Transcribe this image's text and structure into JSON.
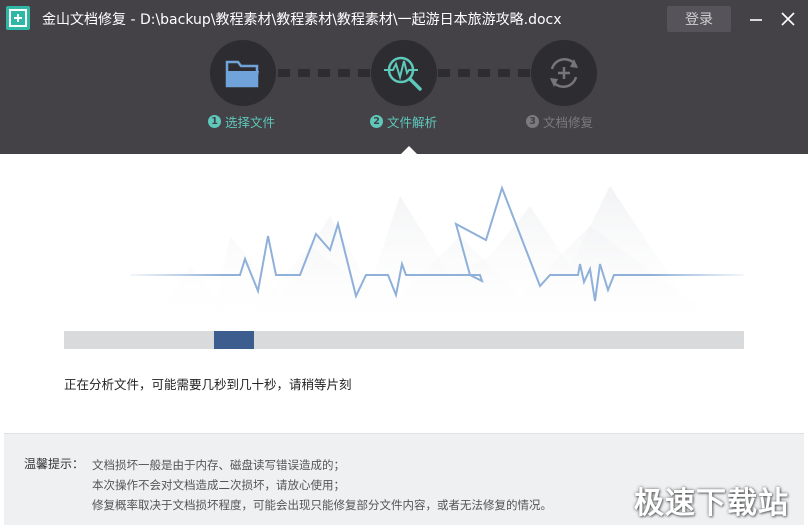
{
  "window": {
    "title": "金山文档修复 - D:\\backup\\教程素材\\教程素材\\教程素材\\一起游日本旅游攻略.docx",
    "login_label": "登录"
  },
  "steps": [
    {
      "number": "1",
      "label": "选择文件",
      "state": "done",
      "icon": "folder-icon"
    },
    {
      "number": "2",
      "label": "文件解析",
      "state": "active",
      "icon": "magnifier-pulse-icon"
    },
    {
      "number": "3",
      "label": "文档修复",
      "state": "pending",
      "icon": "repair-cycle-icon"
    }
  ],
  "progress": {
    "status_text": "正在分析文件，可能需要几秒到几十秒，请稍等片刻",
    "indicator_position": 0.22
  },
  "tips": {
    "label": "温馨提示：",
    "lines": [
      "文档损坏一般是由于内存、磁盘读写错误造成的；",
      "本次操作不会对文档造成二次损坏，请放心使用；",
      "修复概率取决于文档损坏程度，可能会出现只能修复部分文件内容，或者无法修复的情况。"
    ]
  },
  "watermark": "极速下载站",
  "colors": {
    "header_bg": "#444247",
    "accent_teal": "#2fb8a6",
    "step_active": "#5ec8bb",
    "step_pending": "#7c7a80",
    "progress_fill": "#3d5d8f",
    "waveform": "#8fb0d8"
  }
}
